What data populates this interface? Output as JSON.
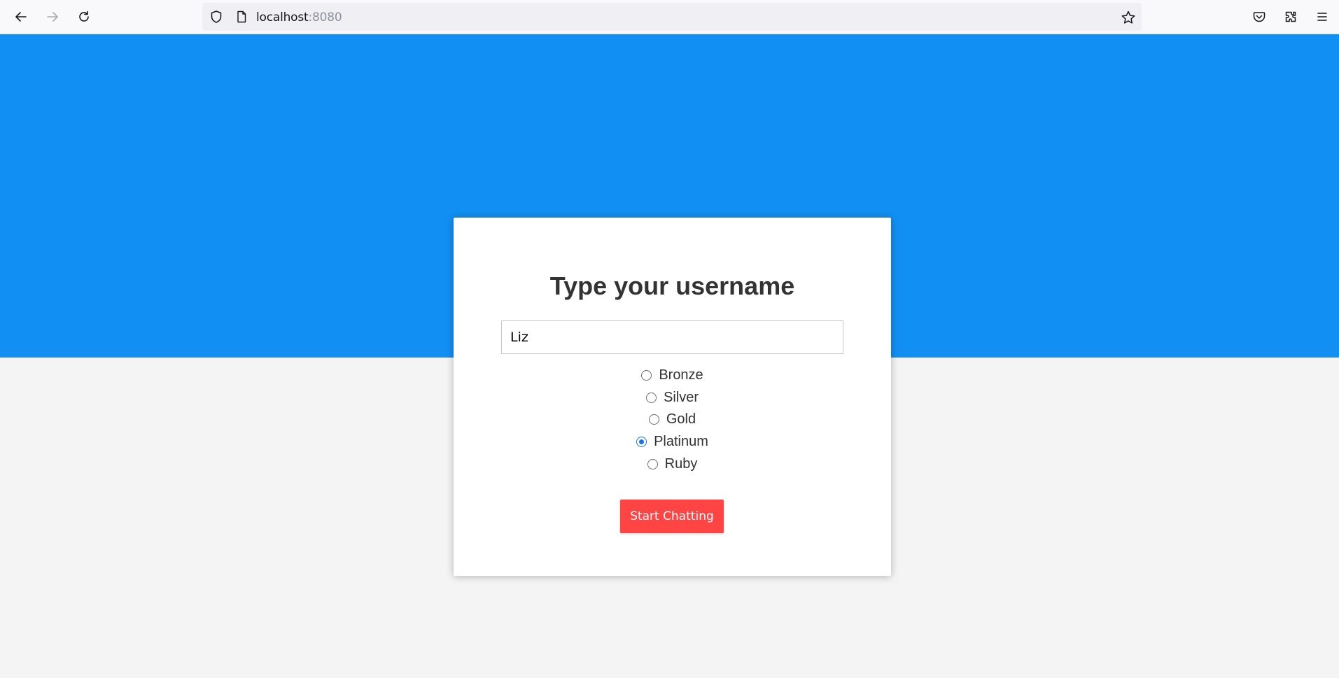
{
  "browser": {
    "url_host": "localhost",
    "url_port": ":8080"
  },
  "card": {
    "title": "Type your username",
    "username_value": "Liz",
    "tiers": [
      {
        "label": "Bronze",
        "checked": false
      },
      {
        "label": "Silver",
        "checked": false
      },
      {
        "label": "Gold",
        "checked": false
      },
      {
        "label": "Platinum",
        "checked": true
      },
      {
        "label": "Ruby",
        "checked": false
      }
    ],
    "button_label": "Start Chatting"
  },
  "colors": {
    "hero": "#128ff2",
    "button": "#ff4444",
    "radio_checked": "#1a73e8",
    "page_bg": "#f4f4f4"
  },
  "icons": {
    "back": "arrow-left-icon",
    "forward": "arrow-right-icon",
    "reload": "reload-icon",
    "shield": "shield-icon",
    "page": "page-icon",
    "bookmark": "star-icon",
    "pocket": "pocket-icon",
    "extensions": "extensions-icon",
    "menu": "hamburger-menu-icon"
  }
}
